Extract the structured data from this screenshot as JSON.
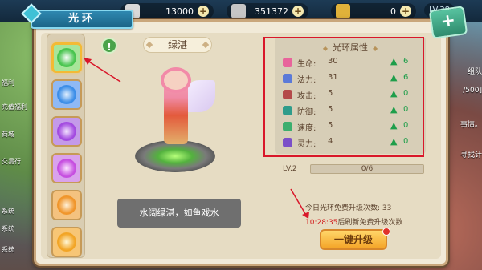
{
  "hud": {
    "silver": "13000",
    "gold": "351372",
    "ingot": "0",
    "level": "LV.38",
    "plus": "+"
  },
  "window": {
    "title": "光环",
    "close_label": "+"
  },
  "aura": {
    "name": "绿湛",
    "description": "水阔绿湛，如鱼戏水",
    "info_label": "!"
  },
  "aura_list": [
    {
      "color": "#49c54f"
    },
    {
      "color": "#3c8ee8"
    },
    {
      "color": "#a34be0"
    },
    {
      "color": "#c64fe0"
    },
    {
      "color": "#f0962c"
    },
    {
      "color": "#f2a526"
    }
  ],
  "attributes": {
    "title": "光环属性",
    "rows": [
      {
        "icon": "heart-icon",
        "label": "生命:",
        "value": "30",
        "gain": "6",
        "color": "#e8649b"
      },
      {
        "icon": "mana-icon",
        "label": "法力:",
        "value": "31",
        "gain": "6",
        "color": "#5b7ad8"
      },
      {
        "icon": "sword-icon",
        "label": "攻击:",
        "value": "5",
        "gain": "0",
        "color": "#b44a4a"
      },
      {
        "icon": "shield-icon",
        "label": "防御:",
        "value": "5",
        "gain": "0",
        "color": "#2f9c8b"
      },
      {
        "icon": "speed-icon",
        "label": "速度:",
        "value": "5",
        "gain": "0",
        "color": "#3cae6e"
      },
      {
        "icon": "spirit-icon",
        "label": "灵力:",
        "value": "4",
        "gain": "0",
        "color": "#7b4fc8"
      }
    ]
  },
  "progress": {
    "level": "LV.2",
    "text": "0/6",
    "fraction": 0
  },
  "upgrade": {
    "free_count_text": "今日光环免费升级次数: 33",
    "refresh_time": "10:28:35",
    "refresh_suffix": "后刷新免费升级次数",
    "button_label": "一键升级"
  },
  "background": {
    "side_items": [
      "福利",
      "充值福利",
      "商城",
      "交易行",
      "系统",
      "系统",
      "系统"
    ],
    "right_texts": [
      "组队",
      "/500]",
      "事情。",
      "寻找计"
    ]
  }
}
